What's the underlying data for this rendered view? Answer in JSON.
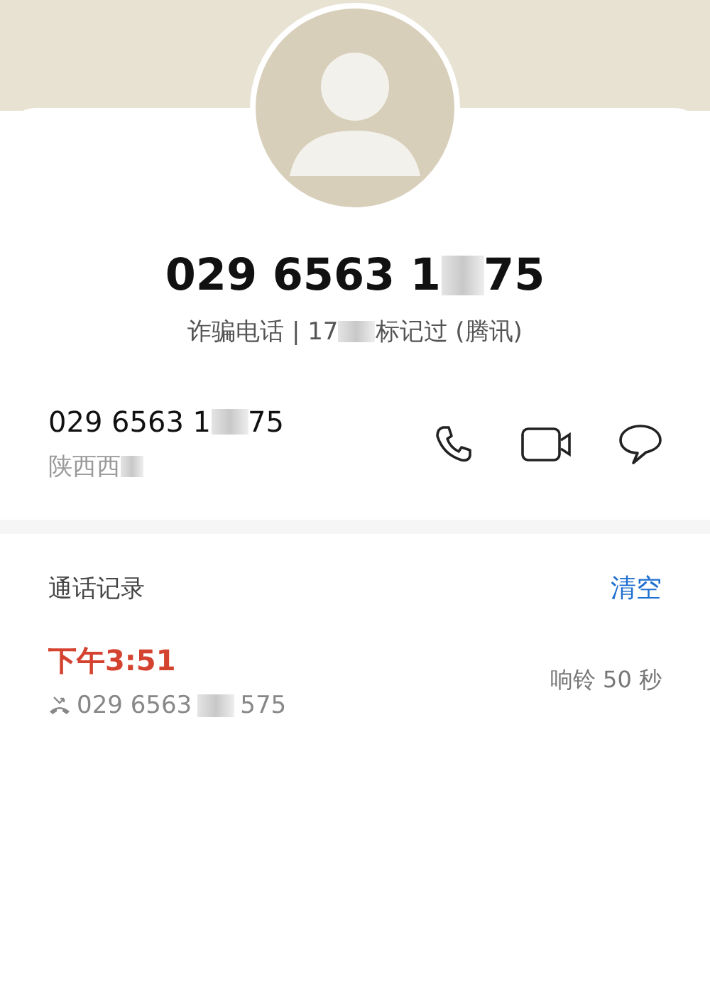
{
  "header": {
    "number": [
      "029 6563 1",
      "75"
    ],
    "tag": [
      "诈骗电话 | 17",
      "标记过 (腾讯)"
    ]
  },
  "contact": {
    "number": [
      "029 6563 1",
      "75"
    ],
    "location": [
      "陕西西"
    ]
  },
  "actions": [
    {
      "kind": "call"
    },
    {
      "kind": "video"
    },
    {
      "kind": "message"
    }
  ],
  "call_log": {
    "title": "通话记录",
    "clear": "清空",
    "entries": [
      {
        "time": "下午3:51",
        "missed": true,
        "number": [
          "029 6563",
          "575"
        ],
        "duration": "响铃 50 秒"
      }
    ]
  }
}
